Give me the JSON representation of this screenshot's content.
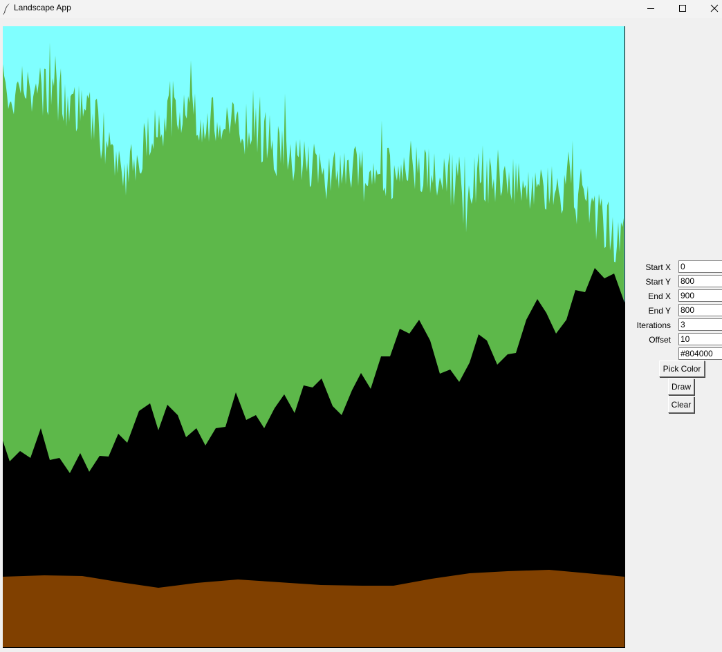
{
  "window": {
    "title": "Landscape App",
    "app_icon": "feather-icon",
    "controls": [
      "minimize-icon",
      "maximize-icon",
      "close-icon"
    ]
  },
  "canvas": {
    "sky_color": "#80ffff",
    "grass_color": "#5db84a",
    "mountain_color": "#000000",
    "ground_color": "#804000"
  },
  "form": {
    "start_x": {
      "label": "Start X",
      "value": "0"
    },
    "start_y": {
      "label": "Start Y",
      "value": "800"
    },
    "end_x": {
      "label": "End X",
      "value": "900"
    },
    "end_y": {
      "label": "End Y",
      "value": "800"
    },
    "iterations": {
      "label": "Iterations",
      "value": "3"
    },
    "offset": {
      "label": "Offset",
      "value": "10"
    },
    "color_value": "#804000"
  },
  "buttons": {
    "pick_color": "Pick Color",
    "draw": "Draw",
    "clear": "Clear"
  }
}
